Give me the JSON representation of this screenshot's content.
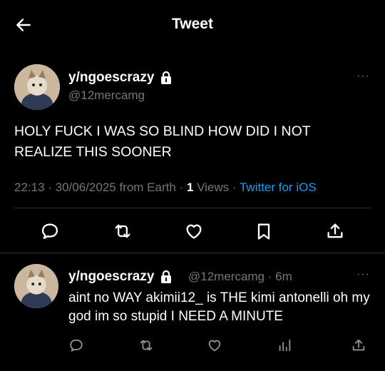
{
  "header": {
    "title": "Tweet",
    "back_icon": "arrow-left-icon"
  },
  "tweet": {
    "display_name": "y/ngoescrazy",
    "handle": "@12mercamg",
    "text": "HOLY FUCK I WAS SO BLIND HOW DID I NOT REALIZE THIS SOONER",
    "time_date": "22:13 · 30/06/2025 from Earth · ",
    "views_count": "1",
    "views_label": " Views · ",
    "source": "Twitter for iOS",
    "more": "···",
    "actions": [
      "reply-icon",
      "retweet-icon",
      "like-icon",
      "bookmark-icon",
      "share-icon"
    ]
  },
  "reply": {
    "display_name": "y/ngoescrazy",
    "meta": "@12mercamg · 6m",
    "text": "aint no WAY akimii12_ is THE kimi antonelli oh my god im so stupid I NEED A MINUTE",
    "more": "···",
    "actions": [
      "reply-icon",
      "retweet-icon",
      "like-icon",
      "views-icon",
      "share-icon"
    ]
  },
  "colors": {
    "background": "#000000",
    "text": "#e7e9ea",
    "muted": "#71767b",
    "accent": "#1d9bf0",
    "divider": "#2f3336"
  }
}
